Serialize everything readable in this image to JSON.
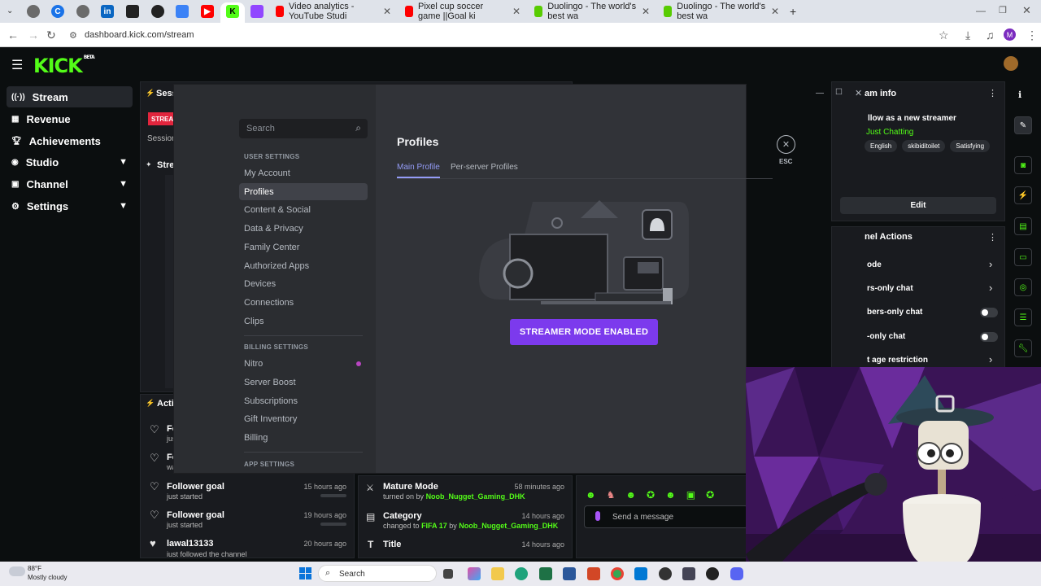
{
  "browser": {
    "url": "dashboard.kick.com/stream",
    "tabs": [
      {
        "label": "Video analytics - YouTube Studi"
      },
      {
        "label": "Pixel cup soccer game ||Goal ki"
      },
      {
        "label": "Duolingo - The world's best wa"
      },
      {
        "label": "Duolingo - The world's best wa"
      }
    ],
    "profile_initial": "M"
  },
  "kick": {
    "logo": "KICK",
    "logo_badge": "BETA",
    "sidebar": [
      {
        "label": "Stream",
        "icon": "stream-icon"
      },
      {
        "label": "Revenue",
        "icon": "revenue-icon"
      },
      {
        "label": "Achievements",
        "icon": "trophy-icon"
      },
      {
        "label": "Studio",
        "icon": "studio-icon"
      },
      {
        "label": "Channel",
        "icon": "channel-icon"
      },
      {
        "label": "Settings",
        "icon": "gear-icon"
      }
    ],
    "session_title": "Sess",
    "stream_badge": "STREA",
    "session_sub": "Session",
    "stream_tab": "Strea",
    "activity_title": "Activ",
    "activity": [
      {
        "title": "Fo",
        "sub": "just"
      },
      {
        "title": "Fo",
        "sub": "wa"
      },
      {
        "title": "Follower goal",
        "sub": "just started",
        "time": "15 hours ago"
      },
      {
        "title": "Follower goal",
        "sub": "just started",
        "time": "19 hours ago"
      },
      {
        "title": "lawal13133",
        "sub": "just followed the channel",
        "time": "20 hours ago"
      }
    ],
    "mod_log": [
      {
        "title": "Mature Mode",
        "pre": "turned on by",
        "user": "Noob_Nugget_Gaming_DHK",
        "time": "58 minutes ago"
      },
      {
        "title": "Category",
        "pre": "changed to",
        "target": "FIFA 17",
        "mid": "by",
        "user": "Noob_Nugget_Gaming_DHK",
        "time": "14 hours ago"
      },
      {
        "title": "Title",
        "time": "14 hours ago"
      }
    ],
    "stream_info": {
      "title": "am info",
      "follow_text": "llow as a new streamer",
      "category": "Just Chatting",
      "tags": [
        "English",
        "skibiditoilet",
        "Satisfying"
      ],
      "edit_label": "Edit"
    },
    "channel_actions": {
      "title": "nel Actions",
      "items": [
        {
          "label": "ode",
          "control": "arrow"
        },
        {
          "label": "rs-only chat",
          "control": "arrow"
        },
        {
          "label": "bers-only chat",
          "control": "toggle"
        },
        {
          "label": "-only chat",
          "control": "toggle"
        },
        {
          "label": "t age restriction",
          "control": "arrow"
        }
      ]
    },
    "chat_placeholder": "Send a message"
  },
  "discord": {
    "search_placeholder": "Search",
    "user_settings_header": "USER SETTINGS",
    "user_settings": [
      "My Account",
      "Profiles",
      "Content & Social",
      "Data & Privacy",
      "Family Center",
      "Authorized Apps",
      "Devices",
      "Connections",
      "Clips"
    ],
    "billing_header": "BILLING SETTINGS",
    "billing": [
      "Nitro",
      "Server Boost",
      "Subscriptions",
      "Gift Inventory",
      "Billing"
    ],
    "app_header": "APP SETTINGS",
    "page_title": "Profiles",
    "tabs": [
      "Main Profile",
      "Per-server Profiles"
    ],
    "streamer_button": "STREAMER MODE ENABLED",
    "esc_label": "ESC"
  },
  "taskbar": {
    "temp": "88°F",
    "weather": "Mostly cloudy",
    "search": "Search"
  }
}
